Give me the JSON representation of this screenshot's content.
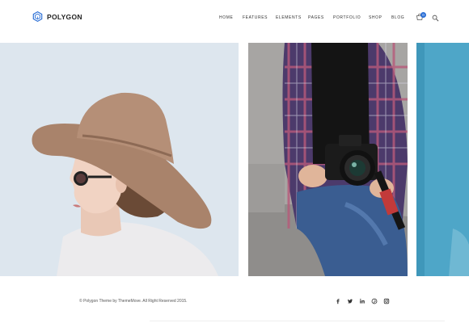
{
  "brand": {
    "name": "POLYGON",
    "logo_icon": "polygon-logo-icon",
    "accent_color": "#2b6fd6"
  },
  "nav": {
    "items": [
      {
        "label": "HOME"
      },
      {
        "label": "FEATURES"
      },
      {
        "label": "ELEMENTS"
      },
      {
        "label": "PAGES"
      },
      {
        "label": "PORTFOLIO"
      },
      {
        "label": "SHOP"
      },
      {
        "label": "BLOG"
      }
    ],
    "cart_icon": "cart-icon",
    "cart_count": "0",
    "search_icon": "search-icon"
  },
  "gallery": {
    "items": [
      {
        "subject": "woman-with-hat"
      },
      {
        "subject": "man-with-camera"
      },
      {
        "subject": "teal-panel"
      }
    ]
  },
  "footer": {
    "copyright": "© Polygon Theme by ThemeMove. All Right Reserved 2015.",
    "social_icons": [
      "facebook-icon",
      "twitter-icon",
      "linkedin-icon",
      "pinterest-icon",
      "instagram-icon"
    ]
  }
}
